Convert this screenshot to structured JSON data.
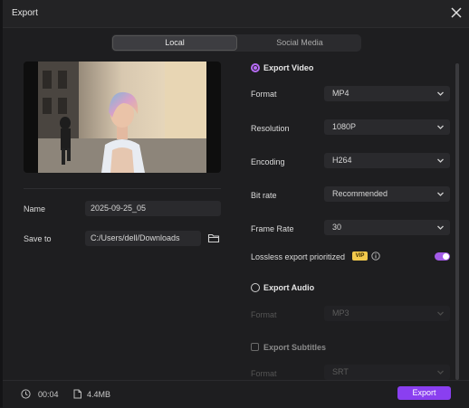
{
  "window": {
    "title": "Export"
  },
  "tabs": [
    {
      "label": "Local",
      "active": true
    },
    {
      "label": "Social Media",
      "active": false
    }
  ],
  "left": {
    "name_label": "Name",
    "name_value": "2025-09-25_05",
    "save_label": "Save to",
    "save_value": "C:/Users/dell/Downloads"
  },
  "video": {
    "section_label": "Export Video",
    "selected": true,
    "format_label": "Format",
    "format_value": "MP4",
    "resolution_label": "Resolution",
    "resolution_value": "1080P",
    "encoding_label": "Encoding",
    "encoding_value": "H264",
    "bitrate_label": "Bit rate",
    "bitrate_value": "Recommended",
    "framerate_label": "Frame Rate",
    "framerate_value": "30",
    "lossless_label": "Lossless export prioritized",
    "vip_badge": "VIP",
    "lossless_on": true
  },
  "audio": {
    "section_label": "Export Audio",
    "selected": false,
    "format_label": "Format",
    "format_value": "MP3"
  },
  "subtitles": {
    "section_label": "Export Subtitles",
    "checked": false,
    "format_label": "Format",
    "format_value": "SRT"
  },
  "footer": {
    "duration": "00:04",
    "size": "4.4MB",
    "export_label": "Export"
  },
  "colors": {
    "accent": "#8a3ff0",
    "radio_accent": "#b66cf4",
    "vip": "#f2c94c"
  }
}
